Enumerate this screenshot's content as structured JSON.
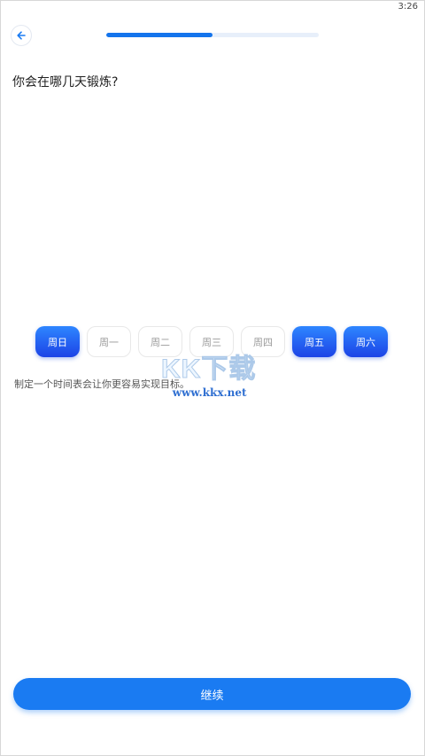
{
  "status_bar": {
    "time": "3:26"
  },
  "header": {
    "back_icon": "arrow-left-icon",
    "progress": 0.5,
    "accent_color": "#1474ec"
  },
  "question": {
    "title": "你会在哪几天锻炼?"
  },
  "days": [
    {
      "label": "周日",
      "selected": true
    },
    {
      "label": "周一",
      "selected": false
    },
    {
      "label": "周二",
      "selected": false
    },
    {
      "label": "周三",
      "selected": false
    },
    {
      "label": "周四",
      "selected": false
    },
    {
      "label": "周五",
      "selected": true
    },
    {
      "label": "周六",
      "selected": true
    }
  ],
  "hint": "制定一个时间表会让你更容易实现目标。",
  "watermark": {
    "logo": "KK下载",
    "url": "www.kkx.net"
  },
  "footer": {
    "continue_label": "继续",
    "button_color": "#1a7bf2"
  }
}
